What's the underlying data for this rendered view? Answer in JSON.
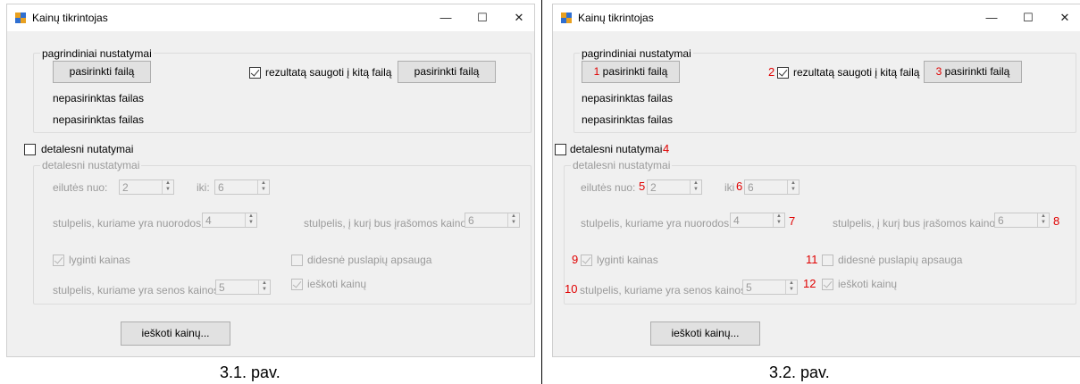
{
  "left": {
    "window_title": "Kainų tikrintojas",
    "window_controls": {
      "minimize": "—",
      "maximize": "☐",
      "close": "✕"
    },
    "group_main": "pagrindiniai nustatymai",
    "select_file_button": "pasirinkti failą",
    "save_checkbox_label": "rezultatą saugoti į kitą failą",
    "select_output_button": "pasirinkti failą",
    "file_status_1": "nepasirinktas failas",
    "file_status_2": "nepasirinktas failas",
    "detailed_checkbox_label": "detalesni nutatymai",
    "group_detailed": "detalesni nustatymai",
    "rows_from_label": "eilutės nuo:",
    "rows_from_value": "2",
    "rows_to_label": "iki:",
    "rows_to_value": "6",
    "links_column_label": "stulpelis, kuriame yra nuorodos",
    "links_column_value": "4",
    "prices_write_label": "stulpelis, į kurį bus įrašomos kainos",
    "prices_write_value": "6",
    "compare_label": "lyginti kainas",
    "protection_label": "didesnė puslapių apsauga",
    "old_prices_label": "stulpelis, kuriame yra senos kainos",
    "old_prices_value": "5",
    "search_prices_label": "ieškoti kainų",
    "search_button": "ieškoti kainų...",
    "caption": "3.1. pav."
  },
  "right": {
    "window_title": "Kainų tikrintojas",
    "window_controls": {
      "minimize": "—",
      "maximize": "☐",
      "close": "✕"
    },
    "group_main": "pagrindiniai nustatymai",
    "select_file_button": "pasirinkti failą",
    "save_checkbox_label": "rezultatą saugoti į kitą failą",
    "select_output_button": "pasirinkti failą",
    "file_status_1": "nepasirinktas failas",
    "file_status_2": "nepasirinktas failas",
    "detailed_checkbox_label": "detalesni nutatymai",
    "group_detailed": "detalesni nustatymai",
    "rows_from_label": "eilutės nuo:",
    "rows_from_value": "2",
    "rows_to_label": "iki",
    "rows_to_value": "6",
    "links_column_label": "stulpelis, kuriame yra nuorodos",
    "links_column_value": "4",
    "prices_write_label": "stulpelis, į kurį bus įrašomos kainos",
    "prices_write_value": "6",
    "compare_label": "lyginti kainas",
    "protection_label": "didesnė puslapių apsauga",
    "old_prices_label": "stulpelis, kuriame yra senos kainos",
    "old_prices_value": "5",
    "search_prices_label": "ieškoti kainų",
    "search_button": "ieškoti kainų...",
    "caption": "3.2. pav.",
    "markers": [
      "1",
      "2",
      "3",
      "4",
      "5",
      "6",
      "7",
      "8",
      "9",
      "10",
      "11",
      "12"
    ]
  },
  "colors": {
    "marker": "#e00000",
    "window_bg": "#f0f0f0",
    "disabled_text": "#9a9a9a"
  }
}
